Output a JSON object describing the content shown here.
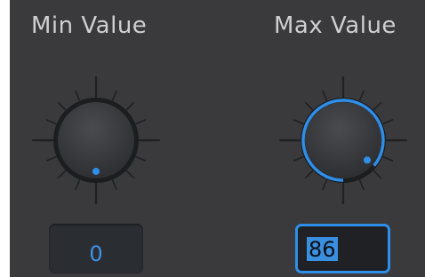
{
  "min": {
    "label": "Min Value",
    "value": "0",
    "knob_fraction": 0.0
  },
  "max": {
    "label": "Max Value",
    "value": "86",
    "knob_fraction": 0.86
  },
  "colors": {
    "panel": "#3a3a3c",
    "accent": "#2f8ee8",
    "label": "#cfcfd1",
    "tick": "#1f2022"
  },
  "icons": [
    "knob-icon"
  ]
}
